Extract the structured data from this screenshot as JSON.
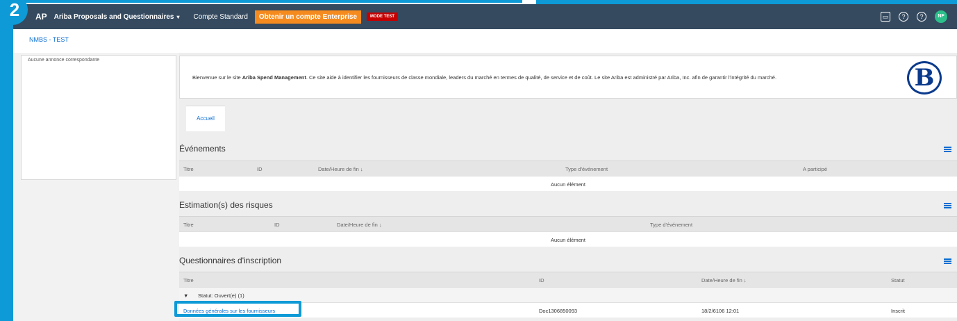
{
  "step": "2",
  "header": {
    "logo": "AP",
    "app_name": "Ariba Proposals and Questionnaires",
    "caret": "▾",
    "account_type": "Compte Standard",
    "enterprise_button": "Obtenir un compte Enterprise",
    "mode_badge": "MODE TEST",
    "user_initials": "NF"
  },
  "breadcrumb": "NMBS - TEST",
  "sidebar": {
    "message": "Aucune annonce correspondante"
  },
  "welcome": {
    "prefix": "Bienvenue sur le site ",
    "site_name": "Ariba Spend Management",
    "suffix": ". Ce site aide à identifier les fournisseurs de classe mondiale, leaders du marché en termes de qualité, de service et de coût. Le site Ariba est administré par Ariba, Inc. afin de garantir l'intégrité du marché.",
    "logo_letter": "B"
  },
  "tabs": {
    "home": "Accueil"
  },
  "events": {
    "title": "Événements",
    "columns": [
      "Titre",
      "ID",
      "Date/Heure de fin ↓",
      "Type d'événement",
      "A participé"
    ],
    "empty": "Aucun élément"
  },
  "risks": {
    "title": "Estimation(s) des risques",
    "columns": [
      "Titre",
      "ID",
      "Date/Heure de fin ↓",
      "Type d'événement"
    ],
    "empty": "Aucun élément"
  },
  "questionnaires": {
    "title": "Questionnaires d'inscription",
    "columns": [
      "Titre",
      "ID",
      "Date/Heure de fin ↓",
      "Statut"
    ],
    "group_label": "Statut: Ouvert(e)  (1)",
    "rows": [
      {
        "title": "Données générales sur les fournisseurs",
        "id": "Doc1306850093",
        "end": "18/2/6106 12:01",
        "status": "Inscrit"
      }
    ]
  },
  "colors": {
    "header_bg": "#354a5f",
    "accent": "#0a6ed1",
    "enterprise": "#f58b1f",
    "mode_test": "#c60000",
    "overlay": "#0d9ad6"
  }
}
